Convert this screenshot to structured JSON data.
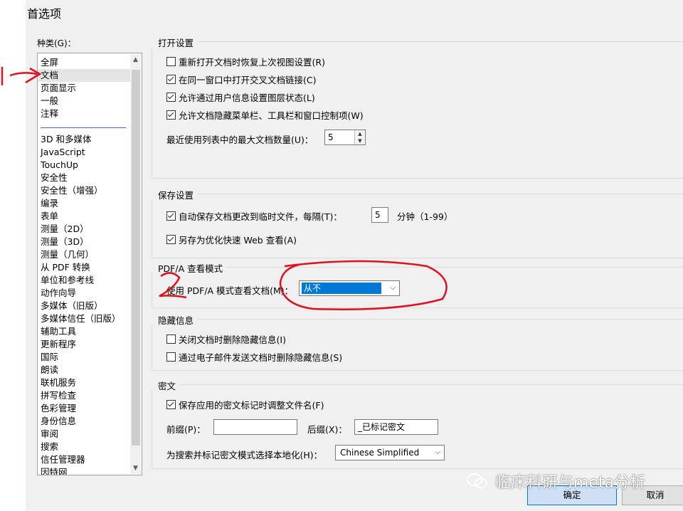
{
  "dialog": {
    "title": "首选项"
  },
  "categories": {
    "label": "种类(G)：",
    "top_items": [
      "全屏",
      "文档",
      "页面显示",
      "一般",
      "注释"
    ],
    "selected": "文档",
    "items": [
      "3D 和多媒体",
      "JavaScript",
      "TouchUp",
      "安全性",
      "安全性（增强）",
      "编录",
      "表单",
      "测量（2D）",
      "测量（3D）",
      "测量（几何）",
      "从 PDF 转换",
      "单位和参考线",
      "动作向导",
      "多媒体（旧版）",
      "多媒体信任（旧版）",
      "辅助工具",
      "更新程序",
      "国际",
      "朗读",
      "联机服务",
      "拼写检查",
      "色彩管理",
      "身份信息",
      "审阅",
      "搜索",
      "信任管理器",
      "因特网"
    ]
  },
  "open_settings": {
    "title": "打开设置",
    "checkboxes": [
      {
        "label": "重新打开文档时恢复上次视图设置(R)",
        "checked": false
      },
      {
        "label": "在同一窗口中打开交叉文档链接(C)",
        "checked": true
      },
      {
        "label": "允许通过用户信息设置图层状态(L)",
        "checked": true
      },
      {
        "label": "允许文档隐藏菜单栏、工具栏和窗口控制项(W)",
        "checked": true
      }
    ],
    "recent_label": "最近使用列表中的最大文档数量(U)：",
    "recent_value": "5"
  },
  "save_settings": {
    "title": "保存设置",
    "autosave_label": "自动保存文档更改到临时文件，每隔(T)：",
    "autosave_checked": true,
    "autosave_value": "5",
    "autosave_unit": "分钟（1-99）",
    "optimize_label": "另存为优化快速 Web 查看(A)",
    "optimize_checked": true
  },
  "pdfa": {
    "title": "PDF/A 查看模式",
    "label": "使用 PDF/A 模式查看文档(M)：",
    "value": "从不"
  },
  "hidden_info": {
    "title": "隐藏信息",
    "checkboxes": [
      {
        "label": "关闭文档时删除隐藏信息(I)",
        "checked": false
      },
      {
        "label": "通过电子邮件发送文档时删除隐藏信息(S)",
        "checked": false
      }
    ]
  },
  "redaction": {
    "title": "密文",
    "adjust_label": "保存应用的密文标记时调整文件名(F)",
    "adjust_checked": true,
    "prefix_label": "前缀(P)：",
    "prefix_value": "",
    "suffix_label": "后缀(X)：",
    "suffix_value": "_已标记密文",
    "locale_label": "为搜索并标记密文模式选择本地化(H)：",
    "locale_value": "Chinese Simplified"
  },
  "buttons": {
    "ok": "确定",
    "cancel": "取消"
  },
  "annotations": {
    "mark1": "1",
    "mark2": "2"
  },
  "watermark": "临床科研与meta分析",
  "colors": {
    "annotation": "#e0101e",
    "selection": "#0078d7"
  }
}
